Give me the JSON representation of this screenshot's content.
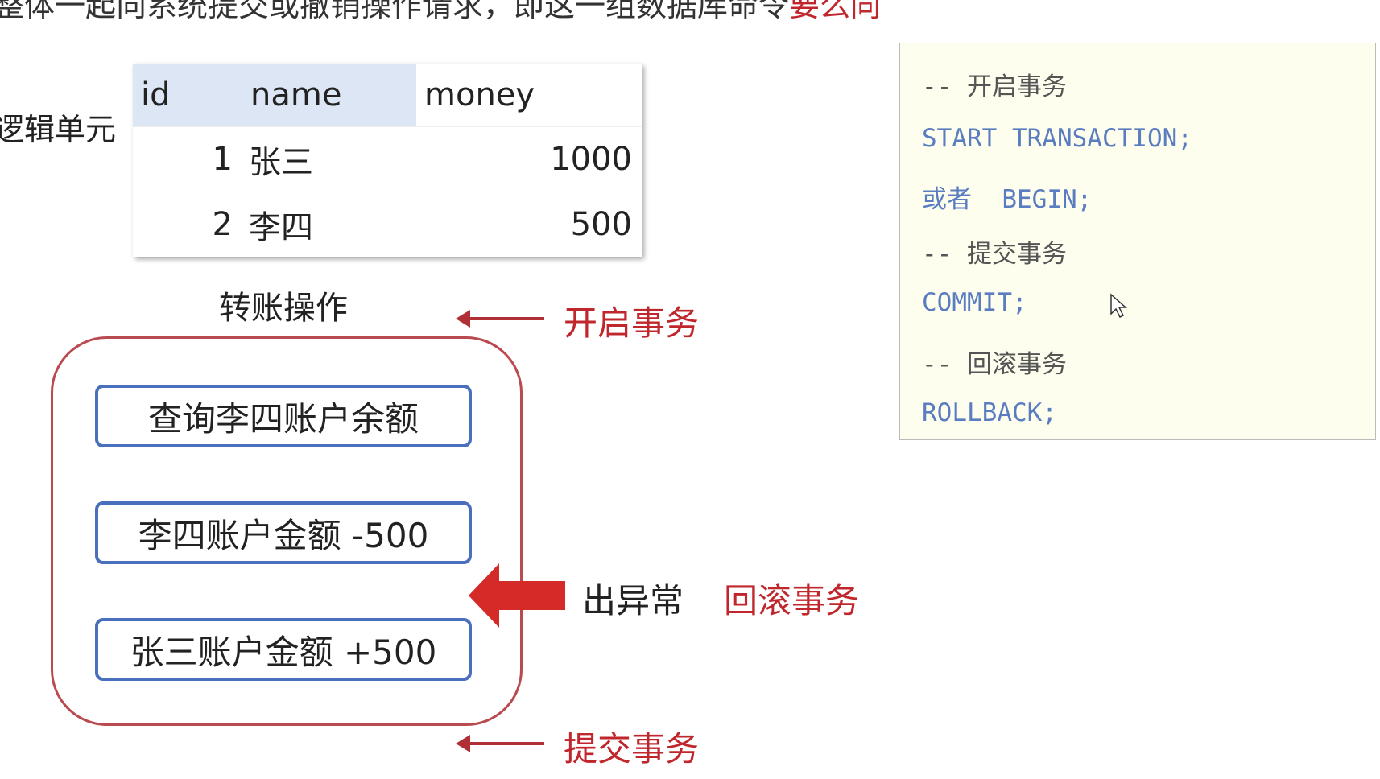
{
  "top_text": {
    "main": "整体一起向系统提交或撤销操作请求，即这一组数据库命令",
    "red": "要么同"
  },
  "label_unit": "逻辑单元",
  "table": {
    "headers": [
      "id",
      "name",
      "money"
    ],
    "rows": [
      [
        "1",
        "张三",
        "1000"
      ],
      [
        "2",
        "李四",
        "500"
      ]
    ]
  },
  "operation_title": "转账操作",
  "steps": [
    "查询李四账户余额",
    "李四账户金额 -500",
    "张三账户金额 +500"
  ],
  "annotations": {
    "begin": "开启事务",
    "exception": "出异常",
    "rollback": "回滚事务",
    "commit": "提交事务"
  },
  "code": [
    "-- 开启事务",
    "START TRANSACTION;",
    "或者  BEGIN;",
    "-- 提交事务",
    "COMMIT;",
    "-- 回滚事务",
    "ROLLBACK;"
  ]
}
